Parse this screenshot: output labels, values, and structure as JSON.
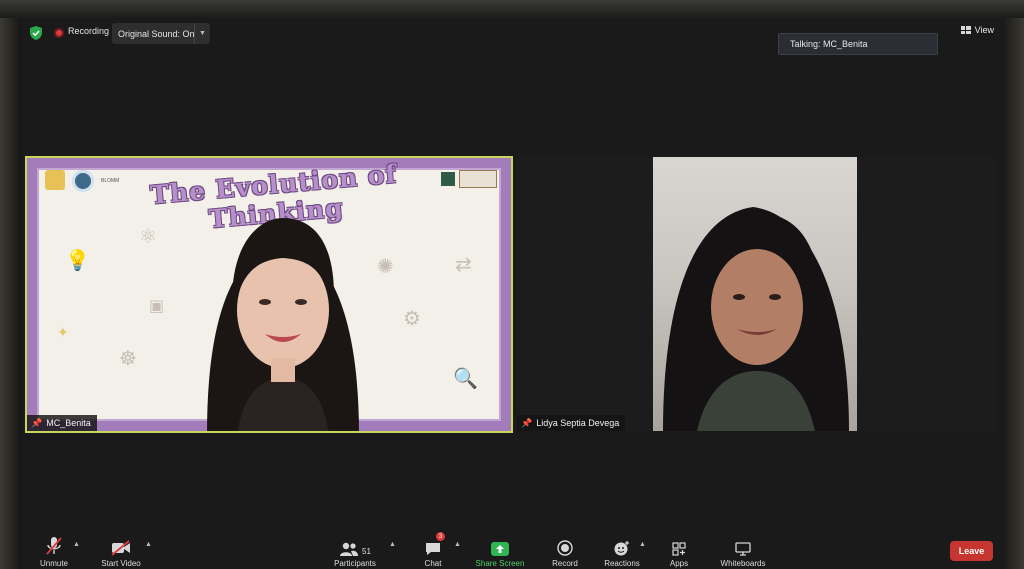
{
  "topbar": {
    "recording_label": "Recording",
    "sound_label": "Original Sound: On",
    "view_label": "View"
  },
  "talking_indicator": "Talking: MC_Benita",
  "tiles": [
    {
      "name": "MC_Benita",
      "slide_title": "The Evolution of Thinking",
      "slide_logo_text": "BLOMM",
      "active_speaker": true
    },
    {
      "name": "Lidya Septia Devega",
      "active_speaker": false
    }
  ],
  "toolbar": {
    "unmute": "Unmute",
    "start_video": "Start Video",
    "participants": "Participants",
    "participants_count": "51",
    "chat": "Chat",
    "chat_badge": "3",
    "share_screen": "Share Screen",
    "record": "Record",
    "reactions": "Reactions",
    "apps": "Apps",
    "whiteboards": "Whiteboards",
    "leave": "Leave"
  },
  "colors": {
    "active_speaker_border": "#c9d55c",
    "recording_dot": "#e0393e",
    "share_screen_green": "#4fd06a",
    "leave_red": "#c6352f",
    "slide_purple": "#a37dbb"
  }
}
